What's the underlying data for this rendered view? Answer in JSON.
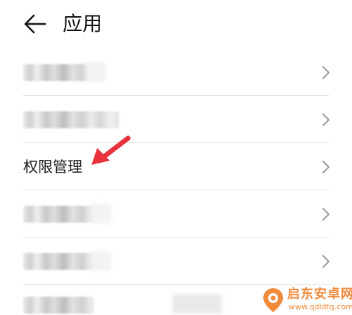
{
  "header": {
    "title": "应用"
  },
  "list": {
    "items": [
      {
        "label": "",
        "obscured": true
      },
      {
        "label": "",
        "obscured": true
      },
      {
        "label": "权限管理",
        "obscured": false
      },
      {
        "label": "",
        "obscured": true
      },
      {
        "label": "",
        "obscured": true
      },
      {
        "label": "",
        "obscured": true
      }
    ]
  },
  "annotation": {
    "arrow_color": "#e8323c"
  },
  "watermark": {
    "title": "启东安卓网",
    "url": "www.qdldtq.com",
    "color": "#f08a3c"
  },
  "icons": {
    "back": "arrow-left-icon",
    "chevron": "chevron-right-icon"
  }
}
